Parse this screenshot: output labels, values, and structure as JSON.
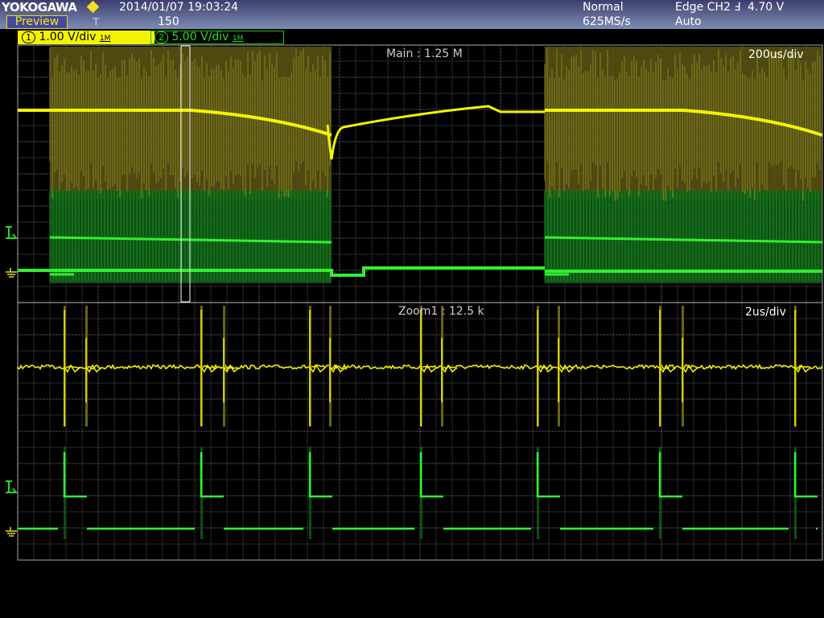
{
  "header": {
    "brand": "YOKOGAWA",
    "mode_button": "Preview",
    "datetime": "2014/01/07 19:03:24",
    "acq_count": "150",
    "acq_mode": "Normal",
    "sample_rate": "625MS/s",
    "trigger": "Edge CH2",
    "trigger_level": "4.70 V",
    "trigger_mode": "Auto"
  },
  "channels": [
    {
      "id": "1",
      "scale": "1.00 V/div",
      "impedance": "1M",
      "color": "#f4f400"
    },
    {
      "id": "2",
      "scale": "5.00 V/div",
      "impedance": "1M",
      "color": "#20e020"
    }
  ],
  "chart_data": [
    {
      "type": "line",
      "title": "Main : 1.25 M",
      "timebase": "200us/div",
      "divisions": {
        "x": 10,
        "y": 8
      },
      "grid": true,
      "series": [
        {
          "name": "CH1",
          "description": "burst envelope with baseline",
          "color": "#f4f400",
          "bursts_div": [
            [
              0.4,
              3.9
            ],
            [
              6.55,
              10
            ]
          ]
        },
        {
          "name": "CH2",
          "description": "switching bursts",
          "color": "#20e020",
          "bursts_div": [
            [
              0.4,
              3.9
            ],
            [
              6.55,
              10
            ]
          ]
        }
      ],
      "zoom_window_div": [
        2.03,
        2.14
      ]
    },
    {
      "type": "line",
      "title": "Zoom1 : 12.5 k",
      "timebase": "2us/div",
      "divisions": {
        "x": 10,
        "y": 8
      },
      "grid": true,
      "series": [
        {
          "name": "CH1",
          "color": "#f4f400",
          "spike_times_div": [
            0.58,
            0.85,
            2.28,
            2.56,
            3.63,
            3.88,
            5.01,
            5.27,
            6.46,
            6.72,
            7.98,
            8.26,
            9.66
          ]
        },
        {
          "name": "CH2",
          "color": "#20e020",
          "pulse_times_div": [
            0.58,
            2.28,
            3.63,
            5.01,
            6.46,
            7.98,
            9.66
          ]
        }
      ]
    }
  ]
}
